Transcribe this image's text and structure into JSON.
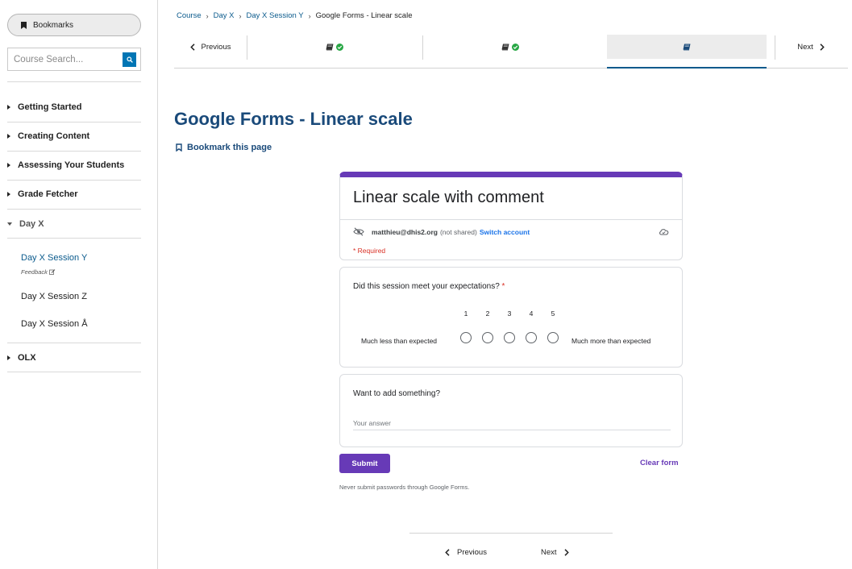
{
  "sidebar": {
    "bookmarks_label": "Bookmarks",
    "search_placeholder": "Course Search...",
    "sections": [
      {
        "label": "Getting Started"
      },
      {
        "label": "Creating Content"
      },
      {
        "label": "Assessing Your Students"
      },
      {
        "label": "Grade Fetcher"
      },
      {
        "label": "Day X"
      },
      {
        "label": "OLX"
      }
    ],
    "subsections": [
      {
        "label": "Day X Session Y",
        "active": true
      },
      {
        "label": "Day X Session Z"
      },
      {
        "label": "Day X Session Å"
      }
    ],
    "feedback_label": "Feedback"
  },
  "breadcrumb": {
    "items": [
      "Course",
      "Day X",
      "Day X Session Y"
    ],
    "current": "Google Forms - Linear scale",
    "separator": "›"
  },
  "sequence_nav": {
    "previous_label": "Previous",
    "next_label": "Next"
  },
  "page": {
    "title": "Google Forms - Linear scale",
    "bookmark_label": "Bookmark this page"
  },
  "form": {
    "title": "Linear scale with comment",
    "account_email": "matthieu@dhis2.org",
    "not_shared": "(not shared)",
    "switch_account": "Switch account",
    "required_note": "* Required",
    "q1": {
      "label": "Did this session meet your expectations?",
      "required_star": "*",
      "scale": [
        "1",
        "2",
        "3",
        "4",
        "5"
      ],
      "low_label": "Much less than expected",
      "high_label": "Much more than expected"
    },
    "q2": {
      "label": "Want to add something?",
      "placeholder": "Your answer"
    },
    "submit_label": "Submit",
    "clear_label": "Clear form",
    "warning": "Never submit passwords through Google Forms."
  },
  "bottom_nav": {
    "previous_label": "Previous",
    "next_label": "Next"
  },
  "colors": {
    "link": "#0a5a8c",
    "title": "#1a4a7a",
    "form_accent": "#673ab7",
    "complete_check": "#28a745",
    "required": "#d93025"
  },
  "icons": {
    "bookmark": "bookmark-icon",
    "search": "search-icon",
    "unit_book": "book-icon",
    "complete": "check-circle-icon",
    "hidden": "eye-off-icon",
    "cloud": "cloud-icon"
  }
}
